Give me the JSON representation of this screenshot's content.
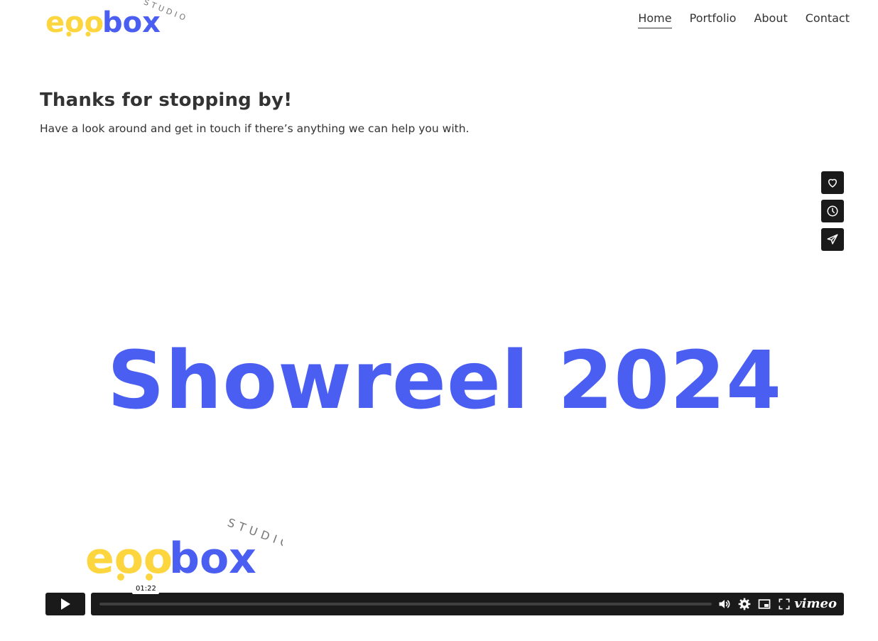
{
  "header": {
    "logo": {
      "word_main": "eoo",
      "word_box": "box",
      "word_studios": "STUDIOS",
      "yellow": "#FCD53F",
      "blue": "#4A5FF2"
    },
    "nav": [
      {
        "label": "Home",
        "active": true
      },
      {
        "label": "Portfolio",
        "active": false
      },
      {
        "label": "About",
        "active": false
      },
      {
        "label": "Contact",
        "active": false
      }
    ]
  },
  "intro": {
    "heading": "Thanks for stopping by!",
    "subtext": "Have a look around and get in touch if there’s anything we can help you with."
  },
  "video": {
    "title_text": "Showreel 2024",
    "title_color": "#4A5FF2",
    "timecode": "01:22",
    "brand": "vimeo",
    "side_buttons": [
      "heart-icon",
      "clock-icon",
      "send-icon"
    ],
    "control_icons": [
      "play-icon",
      "volume-icon",
      "settings-icon",
      "pip-icon",
      "fullscreen-icon"
    ]
  }
}
